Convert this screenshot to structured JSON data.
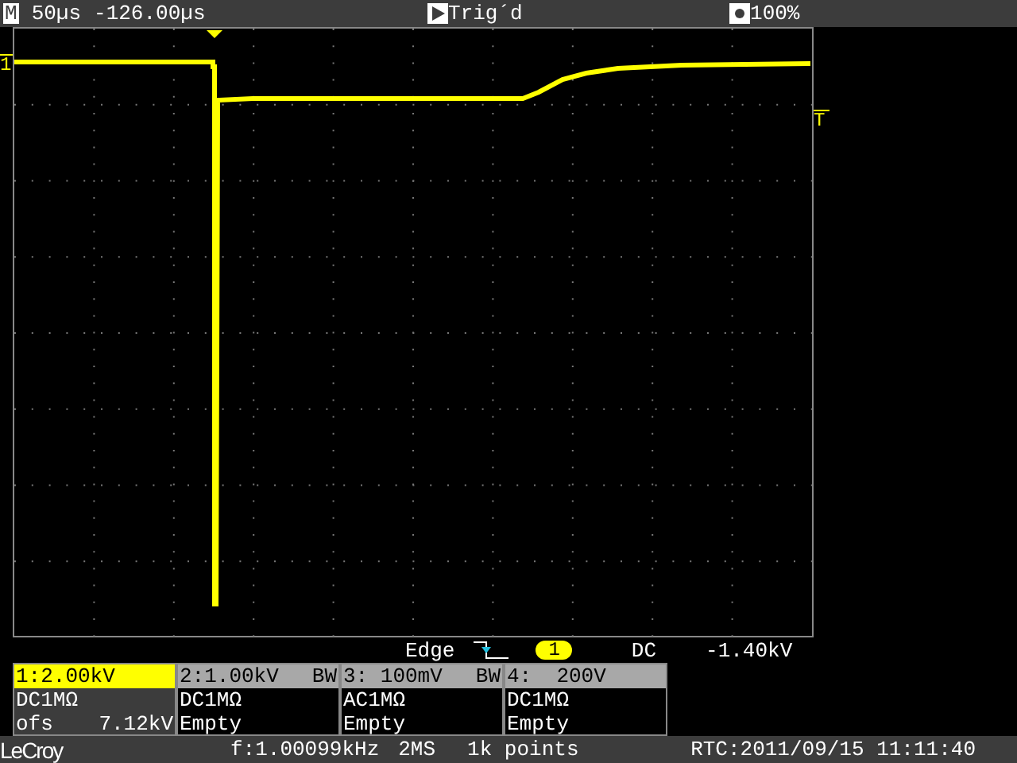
{
  "top_bar": {
    "mode_icon": "M",
    "timebase": "50µs",
    "delay": "-126.00µs",
    "trigger_status": "Trig´d",
    "intensity": "100%"
  },
  "trace": {
    "channel_marker": "1",
    "trigger_level_marker": "T"
  },
  "trigger": {
    "type": "Edge",
    "source": "1",
    "coupling": "DC",
    "level": "-1.40kV"
  },
  "channels": [
    {
      "label": "1:2.00kV",
      "selected": true,
      "coupling": "DC1MΩ",
      "line_2": "ofs",
      "offset": "7.12kV"
    },
    {
      "label": "2:1.00kV",
      "bw": "BW",
      "selected": false,
      "coupling": "DC1MΩ",
      "line_2": "Empty"
    },
    {
      "label": "3: 100mV",
      "bw": "BW",
      "selected": false,
      "coupling": "AC1MΩ",
      "line_2": "Empty"
    },
    {
      "label": "4:  200V",
      "selected": false,
      "coupling": "DC1MΩ",
      "line_2": "Empty"
    }
  ],
  "status_bar": {
    "logo": "LeCroy",
    "frequency": "f:1.00099kHz",
    "sample_rate": "2MS",
    "record_length": "1k points",
    "rtc": "RTC:2011/09/15 11:11:40"
  }
}
